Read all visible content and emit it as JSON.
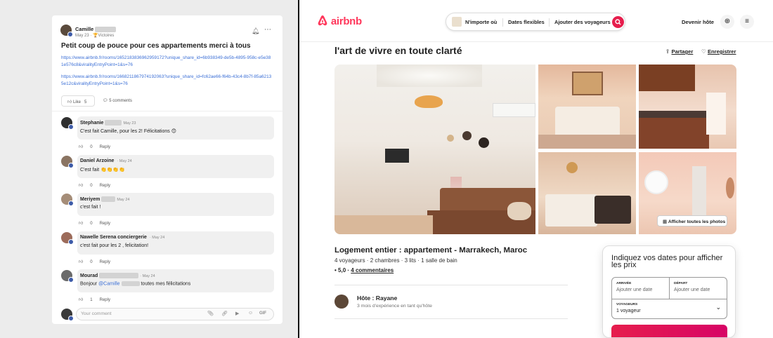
{
  "post": {
    "author": "Camille",
    "date": "May 23",
    "group": "Victoires",
    "title": "Petit coup de pouce pour ces appartements merci à tous",
    "links": [
      "https://www.airbnb.fr/rooms/16521838369629591​72?unique_share_id=6b938349-de5b-4895-958c-e5e381e576c8&viralityEntryPoint=1&s=76",
      "https://www.airbnb.fr/rooms/16682118679741920​63?unique_share_id=fc62ae66-f64b-43c4-8b7f-85a62135e12c&viralityEntryPoint=1&s=76"
    ],
    "like_label": "Like",
    "like_count": "5",
    "comments_label": "5 comments",
    "comments": [
      {
        "name": "Stephanie",
        "date": "May 23",
        "text": "C'est fait Camille, pour les 2! Félicitations 😊",
        "likes": "0",
        "reply": "Reply"
      },
      {
        "name": "Daniel Arzoine",
        "date": "· May 24",
        "text": "C'est fait 👏👏👏👏",
        "likes": "0",
        "reply": "Reply"
      },
      {
        "name": "Meriyem",
        "date": "May 24",
        "text": "c'est fait !",
        "likes": "0",
        "reply": "Reply"
      },
      {
        "name": "Nawelle Serena conciergerie",
        "date": "· May 24",
        "text": "c'est fait pour les 2 , felicitation!",
        "likes": "0",
        "reply": "Reply"
      },
      {
        "name": "Mourad",
        "date": "· May 24",
        "text_prefix": "Bonjour ",
        "mention": "@Camille",
        "text_suffix": "toutes mes félicitations",
        "likes": "1",
        "reply": "Reply"
      }
    ],
    "comment_placeholder": "Your comment",
    "gif_label": "GIF"
  },
  "airbnb": {
    "logo": "airbnb",
    "search": {
      "anywhere": "N'importe où",
      "dates": "Dates flexibles",
      "guests": "Ajouter des voyageurs"
    },
    "become_host": "Devenir hôte",
    "title": "l'art de vivre en toute clarté",
    "share": "Partager",
    "save": "Enregistrer",
    "show_all": "Afficher toutes les photos",
    "subtitle": "Logement entier : appartement - Marrakech, Maroc",
    "details": "4 voyageurs · 2 chambres · 3 lits · 1 salle de bain",
    "rating": "• 5,0 ·",
    "reviews": "4 commentaires",
    "host": "Hôte : Rayane",
    "host_sub": "3 mois d'expérience en tant qu'hôte",
    "booking": {
      "heading": "Indiquez vos dates pour afficher les prix",
      "checkin_label": "ARRIVÉE",
      "checkin_value": "Ajouter une date",
      "checkout_label": "DÉPART",
      "checkout_value": "Ajouter une date",
      "guests_label": "VOYAGEURS",
      "guests_value": "1 voyageur"
    }
  },
  "colors": {
    "accent": "#ff385c",
    "link": "#3b6fd6"
  }
}
